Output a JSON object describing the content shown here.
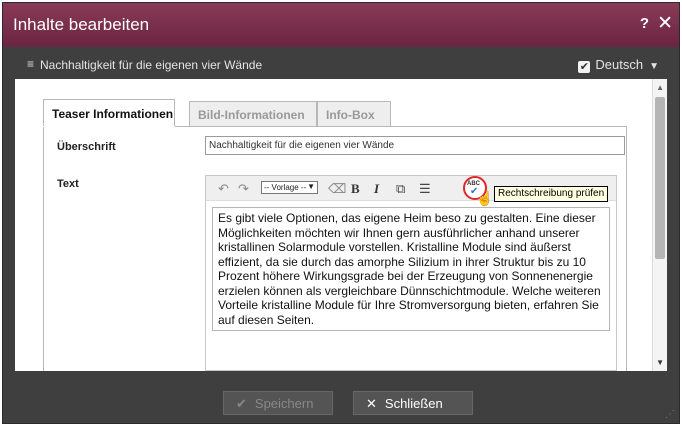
{
  "dialog": {
    "title": "Inhalte bearbeiten",
    "help_label": "?",
    "close_label": "✕"
  },
  "docbar": {
    "icon": "≡",
    "page_title": "Nachhaltigkeit für die eigenen vier Wände",
    "language_checkbox": "✔",
    "language": "Deutsch",
    "language_chevron": "▼"
  },
  "tabs": [
    {
      "label": "Teaser Informationen",
      "active": true
    },
    {
      "label": "Bild-Informationen",
      "active": false
    },
    {
      "label": "Info-Box",
      "active": false
    }
  ],
  "form": {
    "heading_label": "Überschrift",
    "heading_value": "Nachhaltigkeit für die eigenen vier Wände",
    "text_label": "Text",
    "editor": {
      "undo_icon": "↶",
      "redo_icon": "↷",
      "style_select": "-- Vorlage --",
      "style_arrow": "▼",
      "eraser_icon": "⌫",
      "bold": "B",
      "italic": "I",
      "link_icon": "⧉",
      "list_icon": "☰",
      "spell_abc": "ABC",
      "spell_check": "✔",
      "hand_icon": "☝",
      "tooltip": "Rechtschreibung prüfen",
      "body": "Es gibt viele Optionen, das eigene Heim beso zu gestalten. Eine dieser Möglichkeiten möchten wir Ihnen gern ausführlicher anhand unserer kristallinen Solarmodule vorstellen. Kristalline Module sind äußerst effizient, da sie durch das amorphe Silizium in ihrer Struktur bis zu 10 Prozent höhere Wirkungsgrade bei der Erzeugung von Sonnenenergie erzielen können als vergleichbare Dünnschichtmodule. Welche weiteren Vorteile kristalline Module für Ihre Stromversorgung bieten, erfahren Sie auf diesen Seiten."
    }
  },
  "scroll": {
    "up": "▲",
    "down": "▼"
  },
  "footer": {
    "save_icon": "✔",
    "save_label": "Speichern",
    "close_icon": "✕",
    "close_label": "Schließen",
    "grip": "⋰"
  }
}
